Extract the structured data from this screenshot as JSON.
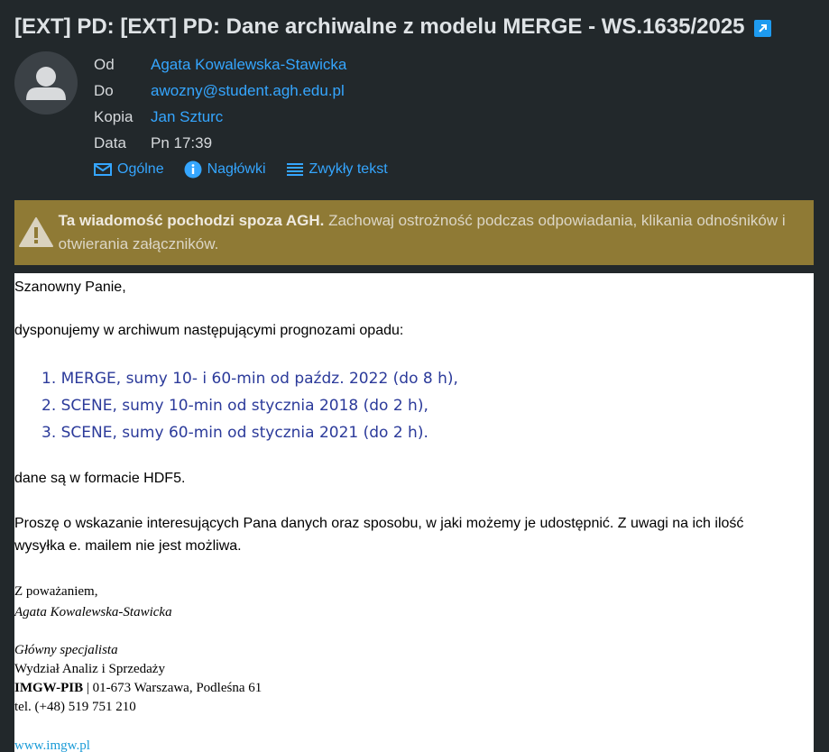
{
  "message": {
    "subject": "[EXT] PD: [EXT] PD: Dane archiwalne z modelu MERGE - WS.1635/2025"
  },
  "header": {
    "from_label": "Od",
    "from_value": "Agata Kowalewska-Stawicka",
    "to_label": "Do",
    "to_value": "awozny@student.agh.edu.pl",
    "cc_label": "Kopia",
    "cc_value": "Jan Szturc",
    "date_label": "Data",
    "date_value": "Pn 17:39"
  },
  "views": {
    "general": "Ogólne",
    "headers": "Nagłówki",
    "plain": "Zwykły tekst"
  },
  "warning": {
    "bold": "Ta wiadomość pochodzi spoza AGH.",
    "text": " Zachowaj ostrożność podczas odpowiadania, klikania odnośników i otwierania załączników."
  },
  "body": {
    "greeting": "Szanowny Panie,",
    "intro": "dysponujemy  w archiwum następującymi prognozami opadu:",
    "list": [
      "1. MERGE, sumy 10- i 60-min od paźdz. 2022 (do 8 h),",
      "2. SCENE, sumy 10-min od stycznia 2018 (do 2 h),",
      "3. SCENE, sumy 60-min od stycznia 2021 (do 2 h)."
    ],
    "format": "dane są w formacie HDF5.",
    "request_line1": "Proszę o wskazanie interesujących Pana danych oraz sposobu, w jaki możemy je udostępnić. Z uwagi na ich ilość",
    "request_line2": "wysyłka e. mailem nie jest możliwa."
  },
  "signature": {
    "regards": "Z poważaniem,",
    "name": "Agata Kowalewska-Stawicka",
    "role": "Główny specjalista",
    "department": "Wydział Analiz i Sprzedaży",
    "org": "IMGW-PIB",
    "address": " | 01-673 Warszawa, Podleśna 61",
    "phone": "tel. (+48) 519 751 210",
    "website": "www.imgw.pl"
  }
}
